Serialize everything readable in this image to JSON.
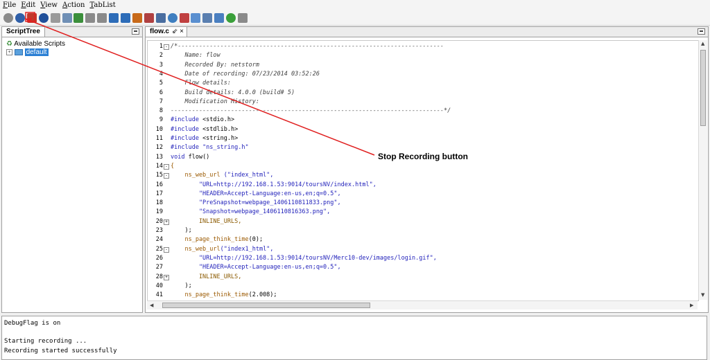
{
  "menu": [
    "File",
    "Edit",
    "View",
    "Action",
    "TabList"
  ],
  "toolbar_icons": [
    {
      "name": "record-icon",
      "color": "#8a8a8a"
    },
    {
      "name": "start-recording-icon",
      "color": "#2f5fa8"
    },
    {
      "name": "stop-recording-icon",
      "color": "#c0392b"
    },
    {
      "name": "pause-icon",
      "color": "#1f4f9a"
    },
    {
      "name": "play-icon",
      "color": "#9a9a9a"
    },
    {
      "name": "comment-icon",
      "color": "#6f8fb5"
    },
    {
      "name": "add-page-icon",
      "color": "#3b8f3b"
    },
    {
      "name": "stop-icon",
      "color": "#8a8a8a"
    },
    {
      "name": "copy-icon",
      "color": "#8a8a8a"
    },
    {
      "name": "move-down-icon",
      "color": "#2d6cb8"
    },
    {
      "name": "move-up-icon",
      "color": "#2d6cb8"
    },
    {
      "name": "transaction-icon",
      "color": "#c86a1a"
    },
    {
      "name": "checkpoint-icon",
      "color": "#b04040"
    },
    {
      "name": "find-icon",
      "color": "#4a6ea0"
    },
    {
      "name": "settings-icon",
      "color": "#3f7fc0"
    },
    {
      "name": "edit-icon",
      "color": "#c04040"
    },
    {
      "name": "web-icon",
      "color": "#5a8fd0"
    },
    {
      "name": "db-icon",
      "color": "#5a7fb0"
    },
    {
      "name": "monitor-icon",
      "color": "#4a7fc0"
    },
    {
      "name": "run-icon",
      "color": "#3aa03a"
    },
    {
      "name": "disabled-icon",
      "color": "#8a8a8a"
    }
  ],
  "left_panel": {
    "tab_label": "ScriptTree",
    "root_label": "Available Scripts",
    "child_label": "default"
  },
  "editor": {
    "tab_label": "flow.c",
    "tab_icons": "⇙ ×"
  },
  "code_lines": [
    {
      "n": "1",
      "fold": "-",
      "parts": [
        {
          "t": "/*---------------------------------------------------------------------------",
          "c": "comment"
        }
      ]
    },
    {
      "n": "2",
      "fold": "",
      "parts": [
        {
          "t": "    Name: flow",
          "c": "comment"
        }
      ]
    },
    {
      "n": "3",
      "fold": "",
      "parts": [
        {
          "t": "    Recorded By: netstorm",
          "c": "comment"
        }
      ]
    },
    {
      "n": "4",
      "fold": "",
      "parts": [
        {
          "t": "    Date of recording: 07/23/2014 03:52:26",
          "c": "comment"
        }
      ]
    },
    {
      "n": "5",
      "fold": "",
      "parts": [
        {
          "t": "    Flow details:",
          "c": "comment"
        }
      ]
    },
    {
      "n": "6",
      "fold": "",
      "parts": [
        {
          "t": "    Build details: 4.0.0 (build# 5)",
          "c": "comment"
        }
      ]
    },
    {
      "n": "7",
      "fold": "",
      "parts": [
        {
          "t": "    Modification History:",
          "c": "comment"
        }
      ]
    },
    {
      "n": "8",
      "fold": "",
      "parts": [
        {
          "t": "-----------------------------------------------------------------------------*/",
          "c": "comment"
        }
      ]
    },
    {
      "n": "9",
      "fold": "",
      "parts": [
        {
          "t": "#include ",
          "c": "pre"
        },
        {
          "t": "<stdio.h>",
          "c": "plain"
        }
      ]
    },
    {
      "n": "10",
      "fold": "",
      "parts": [
        {
          "t": "#include ",
          "c": "pre"
        },
        {
          "t": "<stdlib.h>",
          "c": "plain"
        }
      ]
    },
    {
      "n": "11",
      "fold": "",
      "parts": [
        {
          "t": "#include ",
          "c": "pre"
        },
        {
          "t": "<string.h>",
          "c": "plain"
        }
      ]
    },
    {
      "n": "12",
      "fold": "",
      "parts": [
        {
          "t": "#include ",
          "c": "pre"
        },
        {
          "t": "\"ns_string.h\"",
          "c": "str"
        }
      ]
    },
    {
      "n": "13",
      "fold": "",
      "parts": [
        {
          "t": "void ",
          "c": "kw"
        },
        {
          "t": "flow()",
          "c": "plain"
        }
      ]
    },
    {
      "n": "14",
      "fold": "-",
      "parts": [
        {
          "t": "{",
          "c": "fn"
        }
      ]
    },
    {
      "n": "15",
      "fold": "-",
      "parts": [
        {
          "t": "    ns_web_url ",
          "c": "fn"
        },
        {
          "t": "(\"index_html\",",
          "c": "str"
        }
      ]
    },
    {
      "n": "16",
      "fold": "",
      "parts": [
        {
          "t": "        \"URL=http://192.168.1.53:9014/toursNV/index.html\",",
          "c": "str"
        }
      ]
    },
    {
      "n": "17",
      "fold": "",
      "parts": [
        {
          "t": "        \"HEADER=Accept-Language:en-us,en;q=0.5\",",
          "c": "str"
        }
      ]
    },
    {
      "n": "18",
      "fold": "",
      "parts": [
        {
          "t": "        \"PreSnapshot=webpage_1406110811833.png\",",
          "c": "str"
        }
      ]
    },
    {
      "n": "19",
      "fold": "",
      "parts": [
        {
          "t": "        \"Snapshot=webpage_1406110816363.png\",",
          "c": "str"
        }
      ]
    },
    {
      "n": "20",
      "fold": "+",
      "parts": [
        {
          "t": "        INLINE_URLS,",
          "c": "id"
        }
      ]
    },
    {
      "n": "23",
      "fold": "",
      "parts": [
        {
          "t": "    );",
          "c": "plain"
        }
      ]
    },
    {
      "n": "24",
      "fold": "",
      "parts": [
        {
          "t": "    ns_page_think_time",
          "c": "fn"
        },
        {
          "t": "(0);",
          "c": "plain"
        }
      ]
    },
    {
      "n": "25",
      "fold": "-",
      "parts": [
        {
          "t": "    ns_web_url",
          "c": "fn"
        },
        {
          "t": "(\"index1_html\",",
          "c": "str"
        }
      ]
    },
    {
      "n": "26",
      "fold": "",
      "parts": [
        {
          "t": "        \"URL=http://192.168.1.53:9014/toursNV/Merc10-dev/images/login.gif\",",
          "c": "str"
        }
      ]
    },
    {
      "n": "27",
      "fold": "",
      "parts": [
        {
          "t": "        \"HEADER=Accept-Language:en-us,en;q=0.5\",",
          "c": "str"
        }
      ]
    },
    {
      "n": "28",
      "fold": "+",
      "parts": [
        {
          "t": "        INLINE_URLS,",
          "c": "id"
        }
      ]
    },
    {
      "n": "40",
      "fold": "",
      "parts": [
        {
          "t": "    );",
          "c": "plain"
        }
      ]
    },
    {
      "n": "41",
      "fold": "",
      "parts": [
        {
          "t": "    ns_page_think_time",
          "c": "fn"
        },
        {
          "t": "(2.008);",
          "c": "plain"
        }
      ]
    }
  ],
  "console_lines": [
    "DebugFlag is on",
    "",
    "Starting recording ...",
    "Recording started successfully"
  ],
  "annotation": {
    "label": "Stop Recording button",
    "color": "#e02020"
  }
}
